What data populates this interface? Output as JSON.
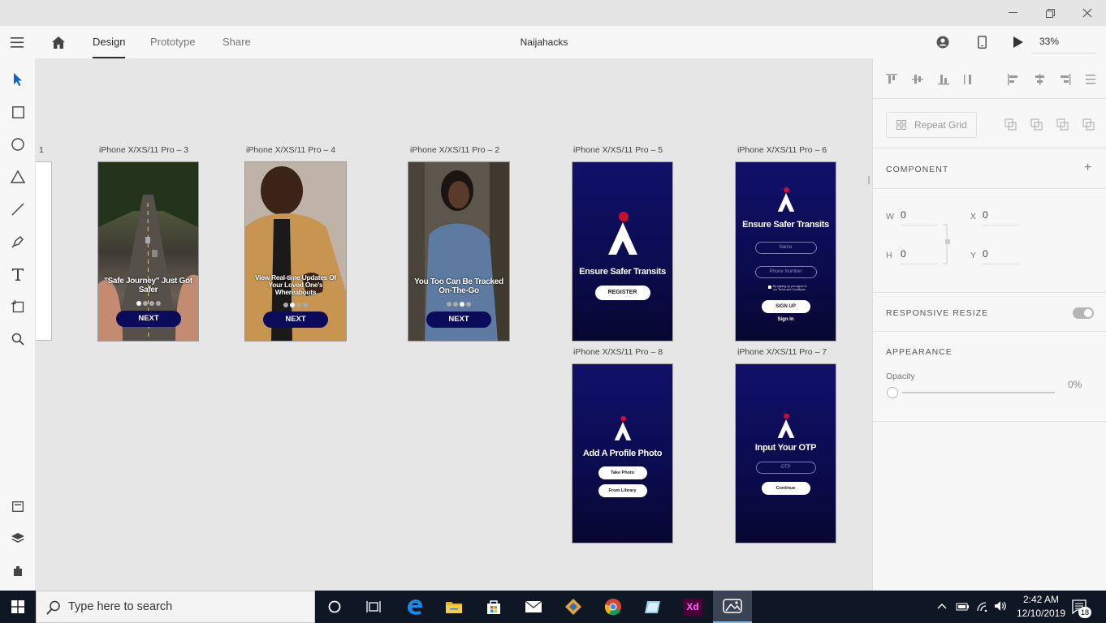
{
  "window": {
    "minimize": "minimize-icon",
    "restore": "restore-icon",
    "close": "close-icon"
  },
  "menubar": {
    "tabs": [
      {
        "label": "Design",
        "active": true
      },
      {
        "label": "Prototype",
        "active": false
      },
      {
        "label": "Share",
        "active": false
      }
    ],
    "doc_title": "Naijahacks",
    "zoom": "33%"
  },
  "toolbar": {
    "tools": [
      "select-icon",
      "rectangle-icon",
      "ellipse-icon",
      "polygon-icon",
      "line-icon",
      "pen-icon",
      "text-icon",
      "artboard-icon",
      "zoom-icon"
    ],
    "bottom": [
      "assets-icon",
      "layers-icon",
      "plugins-icon"
    ]
  },
  "canvas": {
    "partial_label": "1",
    "artboards": [
      {
        "label": "iPhone X/XS/11 Pro – 3",
        "caption": "\"Safe Journey\" Just Got Safer",
        "button": "NEXT",
        "active_dot": 0
      },
      {
        "label": "iPhone X/XS/11 Pro – 4",
        "caption": "View Real-time Updates Of Your Loved One's Whereabouts",
        "button": "NEXT",
        "active_dot": 1
      },
      {
        "label": "iPhone X/XS/11 Pro – 2",
        "caption": "You Too Can Be Tracked On-The-Go",
        "button": "NEXT",
        "active_dot": 2
      },
      {
        "label": "iPhone X/XS/11 Pro – 5",
        "title": "Ensure Safer Transits",
        "button": "REGISTER"
      },
      {
        "label": "iPhone X/XS/11 Pro – 6",
        "title": "Ensure Safer Transits",
        "name_placeholder": "Name",
        "phone_placeholder": "Phone Number",
        "terms": "By signing up you agree to our Terms and Conditions",
        "button": "SIGN UP",
        "link": "Sign In"
      },
      {
        "label": "iPhone X/XS/11 Pro – 8",
        "title": "Add A Profile Photo",
        "button1": "Take Photo",
        "button2": "From Library"
      },
      {
        "label": "iPhone X/XS/11 Pro – 7",
        "title": "Input Your OTP",
        "otp_placeholder": "OTP",
        "button": "Continue"
      }
    ]
  },
  "rpanel": {
    "repeat_grid": "Repeat Grid",
    "component": "COMPONENT",
    "w_label": "W",
    "w": "0",
    "x_label": "X",
    "x": "0",
    "h_label": "H",
    "h": "0",
    "y_label": "Y",
    "y": "0",
    "responsive": "RESPONSIVE RESIZE",
    "appearance": "APPEARANCE",
    "opacity_label": "Opacity",
    "opacity": "0%"
  },
  "taskbar": {
    "search_placeholder": "Type here to search",
    "time": "2:42 AM",
    "date": "12/10/2019",
    "notifications": "18",
    "apps": [
      "cortana-icon",
      "task-view-icon",
      "edge-icon",
      "file-explorer-icon",
      "store-icon",
      "mail-icon",
      "git-icon",
      "chrome-icon",
      "notes-icon",
      "adobe-xd-icon",
      "photos-icon"
    ]
  },
  "colors": {
    "accent": "#0d66d0",
    "navy": "#0b0b4e",
    "logo_red": "#c8102e",
    "taskbar": "#0f1725"
  }
}
